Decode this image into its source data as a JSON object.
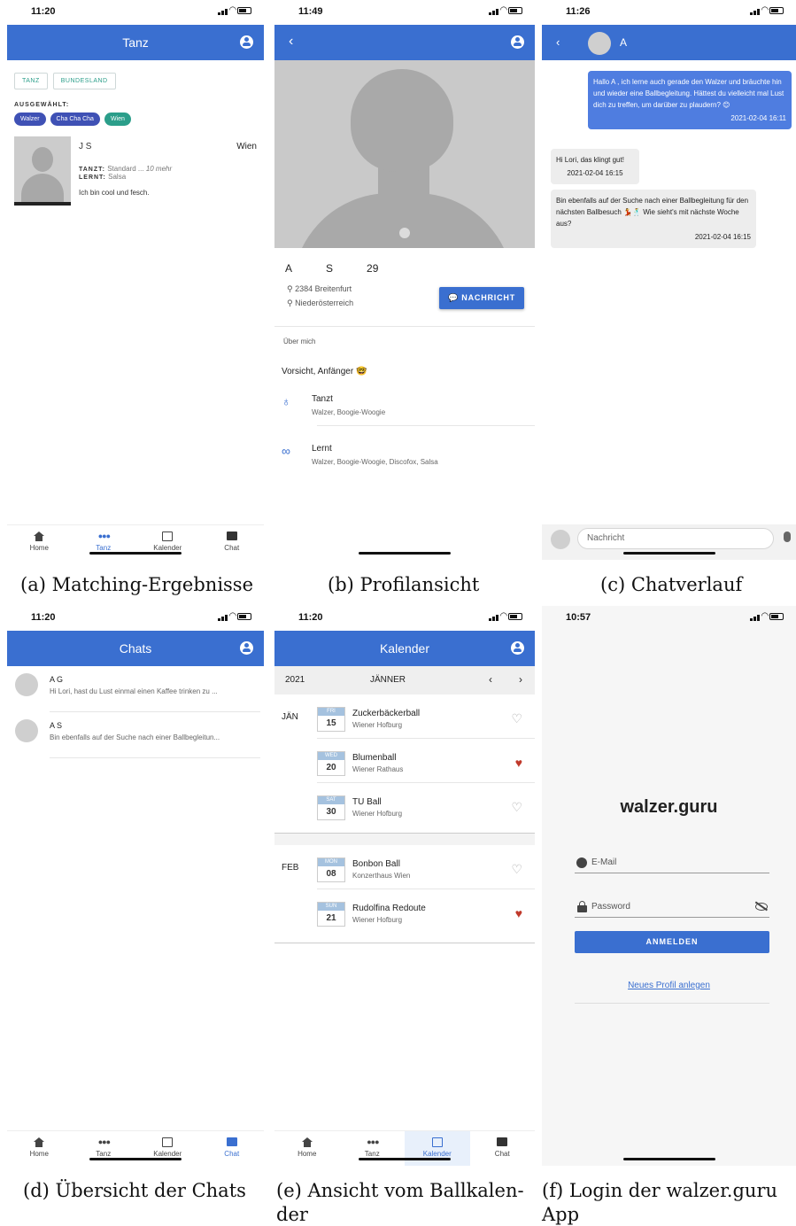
{
  "colors": {
    "primary": "#3a6fd0",
    "teal": "#2b9e8a",
    "heart": "#c0392b"
  },
  "tabs": {
    "home": "Home",
    "tanz": "Tanz",
    "kalender": "Kalender",
    "chat": "Chat"
  },
  "screen_a": {
    "time": "11:20",
    "title": "Tanz",
    "filters": [
      "TANZ",
      "BUNDESLAND"
    ],
    "selected_label": "AUSGEWÄHLT:",
    "selected_chips": [
      {
        "label": "Walzer",
        "color": "#3f51b5"
      },
      {
        "label": "Cha Cha Cha",
        "color": "#3f51b5"
      },
      {
        "label": "Wien",
        "color": "#2b9e8a"
      }
    ],
    "match": {
      "name": "J      S",
      "city": "Wien",
      "tanzt_label": "TANZT:",
      "tanzt": "Standard ...",
      "more": "10 mehr",
      "lernt_label": "LERNT:",
      "lernt": "Salsa",
      "bio": "Ich bin cool und fesch."
    }
  },
  "screen_b": {
    "time": "11:49",
    "name_first": "A",
    "name_last": "S",
    "age": "29",
    "location1": "2384 Breitenfurt",
    "location2": "Niederösterreich",
    "message_button": "NACHRICHT",
    "about_heading": "Über mich",
    "about_text": "Vorsicht, Anfänger 🤓",
    "skills": [
      {
        "title": "Tanzt",
        "items": "Walzer, Boogie-Woogie",
        "icon": "award-icon"
      },
      {
        "title": "Lernt",
        "items": "Walzer, Boogie-Woogie, Discofox, Salsa",
        "icon": "glasses-icon"
      }
    ]
  },
  "screen_c": {
    "time": "11:26",
    "chat_name": "A",
    "messages": [
      {
        "text": "Hallo A    , ich lerne auch gerade den Walzer und bräuchte hin und wieder eine Ballbegleitung. Hättest du vielleicht mal Lust dich zu treffen, um darüber zu plaudern? 😊",
        "time": "2021-02-04 16:11",
        "own": true
      },
      {
        "text": "Hi Lori, das klingt gut!",
        "time": "2021-02-04 16:15",
        "own": false
      },
      {
        "text": "Bin ebenfalls auf der Suche nach einer Ballbegleitung für den nächsten Ballbesuch 💃🕺 Wie sieht's mit nächste Woche aus?",
        "time": "2021-02-04 16:15",
        "own": false
      }
    ],
    "input_placeholder": "Nachricht"
  },
  "screen_d": {
    "time": "11:20",
    "title": "Chats",
    "chats": [
      {
        "name": "A G",
        "preview": "Hi Lori, hast du Lust einmal einen Kaffee trinken zu ..."
      },
      {
        "name": "A      S",
        "preview": "Bin ebenfalls auf der Suche nach einer Ballbegleitun..."
      }
    ]
  },
  "screen_e": {
    "time": "11:20",
    "title": "Kalender",
    "year": "2021",
    "month": "JÄNNER",
    "groups": [
      {
        "month": "JÄN",
        "events": [
          {
            "dow": "FRI",
            "day": "15",
            "name": "Zuckerbäckerball",
            "location": "Wiener Hofburg",
            "liked": false
          },
          {
            "dow": "WED",
            "day": "20",
            "name": "Blumenball",
            "location": "Wiener Rathaus",
            "liked": true
          },
          {
            "dow": "SAT",
            "day": "30",
            "name": "TU Ball",
            "location": "Wiener Hofburg",
            "liked": false
          }
        ]
      },
      {
        "month": "FEB",
        "events": [
          {
            "dow": "MON",
            "day": "08",
            "name": "Bonbon Ball",
            "location": "Konzerthaus Wien",
            "liked": false
          },
          {
            "dow": "SUN",
            "day": "21",
            "name": "Rudolfina Redoute",
            "location": "Wiener Hofburg",
            "liked": true
          }
        ]
      }
    ]
  },
  "screen_f": {
    "time": "10:57",
    "app_title": "walzer.guru",
    "email_placeholder": "E-Mail",
    "password_placeholder": "Password",
    "login_button": "ANMELDEN",
    "new_profile_link": "Neues Profil anlegen"
  },
  "captions": {
    "a": "(a) Matching-Ergebnisse",
    "b": "(b) Profilansicht",
    "c": "(c) Chatverlauf",
    "d": "(d) Übersicht der Chats",
    "e_line1": "(e) Ansicht vom Ballkalen-",
    "e_line2": "der",
    "f_line1": "(f) Login der walzer.guru",
    "f_line2": "App"
  }
}
